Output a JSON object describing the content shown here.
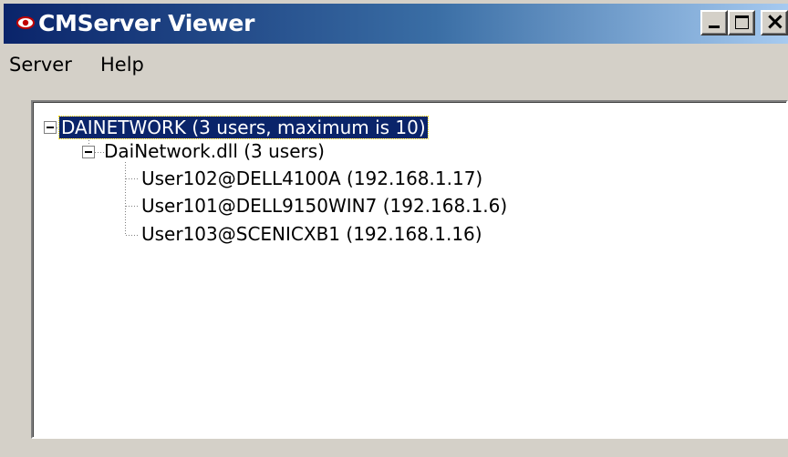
{
  "window": {
    "title": "CMServer Viewer",
    "controls": {
      "minimize": "minimize",
      "maximize": "maximize",
      "close": "close"
    }
  },
  "menubar": {
    "items": [
      {
        "label": "Server"
      },
      {
        "label": "Help"
      }
    ]
  },
  "tree": {
    "root": {
      "label": "DAINETWORK (3 users, maximum is 10)",
      "expanded": true,
      "selected": true,
      "children": [
        {
          "label": "DaiNetwork.dll (3 users)",
          "expanded": true,
          "children": [
            {
              "label": "User102@DELL4100A (192.168.1.17)"
            },
            {
              "label": "User101@DELL9150WIN7 (192.168.1.6)"
            },
            {
              "label": "User103@SCENICXB1 (192.168.1.16)"
            }
          ]
        }
      ]
    }
  },
  "colors": {
    "titlebar_start": "#0a246a",
    "titlebar_end": "#a6caf0",
    "window_bg": "#d4d0c8",
    "selection_bg": "#0a246a"
  }
}
